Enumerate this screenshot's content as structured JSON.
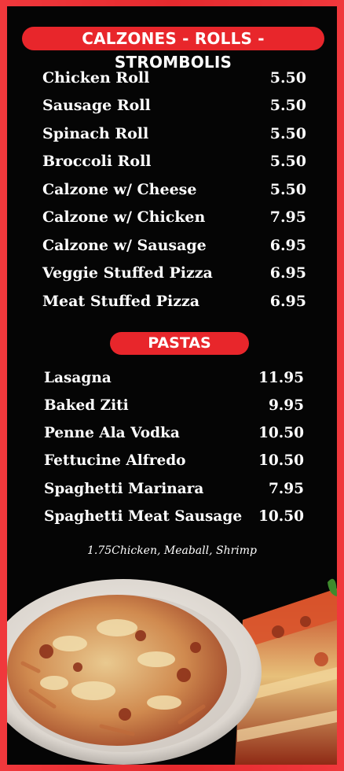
{
  "sections": {
    "calzones": {
      "title": "CALZONES - ROLLS - STROMBOLIS",
      "items": [
        {
          "name": "Chicken Roll",
          "price": "5.50"
        },
        {
          "name": "Sausage Roll",
          "price": "5.50"
        },
        {
          "name": "Spinach Roll",
          "price": "5.50"
        },
        {
          "name": "Broccoli Roll",
          "price": "5.50"
        },
        {
          "name": "Calzone w/ Cheese",
          "price": "5.50"
        },
        {
          "name": "Calzone w/ Chicken",
          "price": "7.95"
        },
        {
          "name": "Calzone w/ Sausage",
          "price": "6.95"
        },
        {
          "name": "Veggie Stuffed Pizza",
          "price": "6.95"
        },
        {
          "name": "Meat Stuffed Pizza",
          "price": "6.95"
        }
      ]
    },
    "pastas": {
      "title": "PASTAS",
      "items": [
        {
          "name": "Lasagna",
          "price": "11.95"
        },
        {
          "name": "Baked Ziti",
          "price": "9.95"
        },
        {
          "name": "Penne Ala Vodka",
          "price": "10.50"
        },
        {
          "name": "Fettucine Alfredo",
          "price": "10.50"
        },
        {
          "name": "Spaghetti Marinara",
          "price": "7.95"
        },
        {
          "name": "Spaghetti Meat Sausage",
          "price": "10.50"
        }
      ],
      "note": "1.75Chicken, Meaball, Shrimp"
    }
  },
  "colors": {
    "accent": "#e8262b",
    "panel": "#050505",
    "text": "#ffffff"
  },
  "images": [
    "baked-ziti-plate-image",
    "lasagna-slice-image"
  ]
}
